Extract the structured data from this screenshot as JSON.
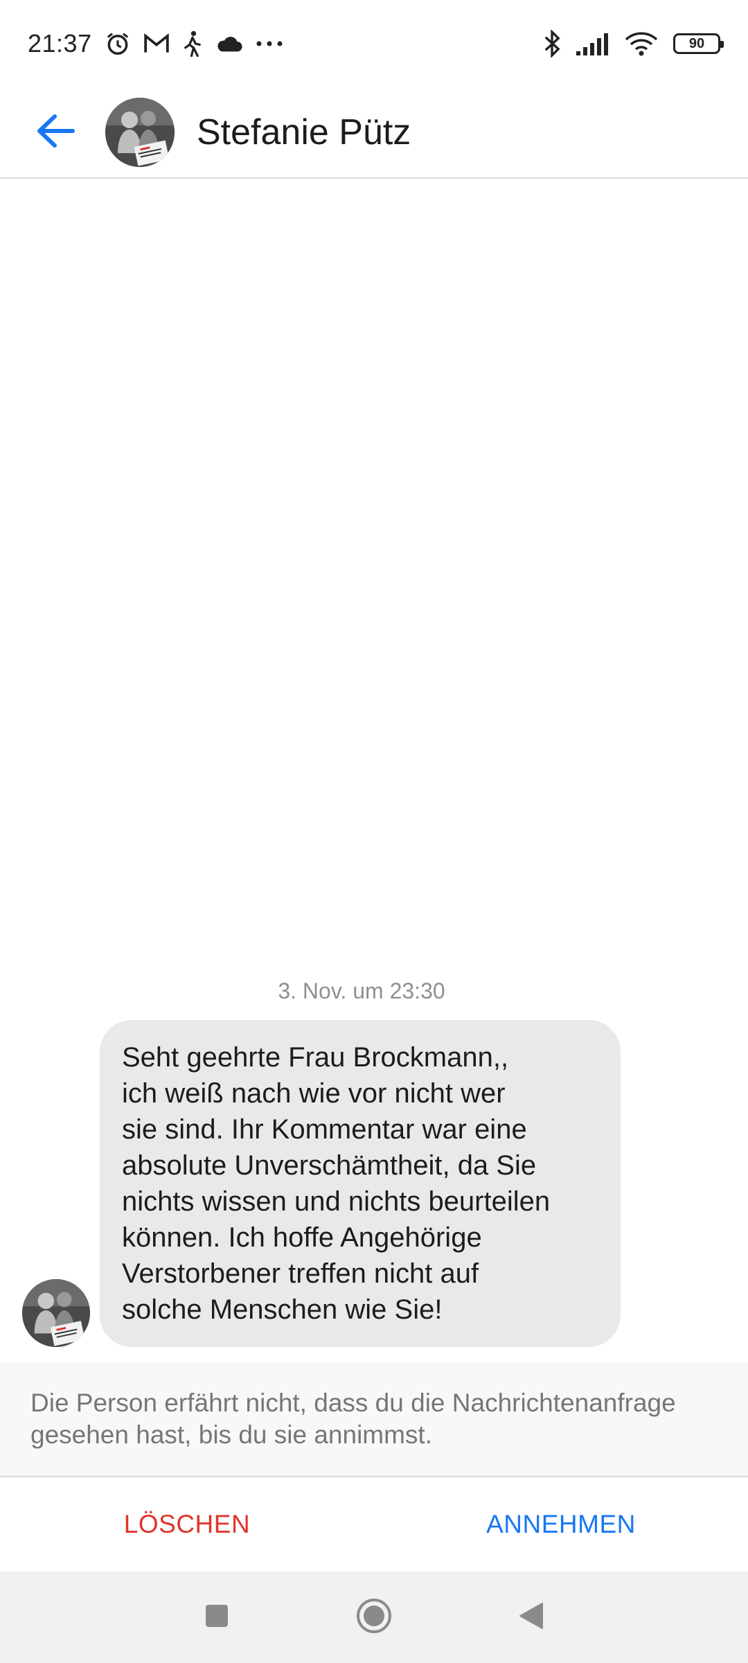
{
  "status_bar": {
    "time": "21:37",
    "battery": "90",
    "left_icons": [
      "alarm-icon",
      "gmail-icon",
      "walking-icon",
      "cloud-icon",
      "more-dots-icon"
    ],
    "right_icons": [
      "bluetooth-icon",
      "signal-icon",
      "wifi-icon",
      "battery-icon"
    ]
  },
  "header": {
    "contact_name": "Stefanie Pütz",
    "back_icon": "arrow-left-icon",
    "accent_color": "#1877f2"
  },
  "conversation": {
    "timestamp": "3. Nov. um 23:30",
    "message": {
      "lines": [
        "Seht geehrte Frau Brockmann,,",
        "ich weiß nach wie vor nicht wer",
        "sie sind. Ihr Kommentar war eine",
        "absolute Unverschämtheit, da Sie",
        "nichts wissen und nichts beurteilen",
        "können. Ich hoffe Angehörige",
        "Verstorbener treffen nicht auf",
        "solche Menschen wie Sie!"
      ]
    }
  },
  "request": {
    "info_text": "Die Person erfährt nicht, dass du die Nachrichtenanfrage gesehen hast, bis du sie annimmst.",
    "delete_label": "LÖSCHEN",
    "accept_label": "ANNEHMEN",
    "delete_color": "#e0352b",
    "accept_color": "#1877f2"
  },
  "nav_bar": {
    "icons": [
      "recents-square-icon",
      "home-circle-icon",
      "back-triangle-icon"
    ]
  }
}
